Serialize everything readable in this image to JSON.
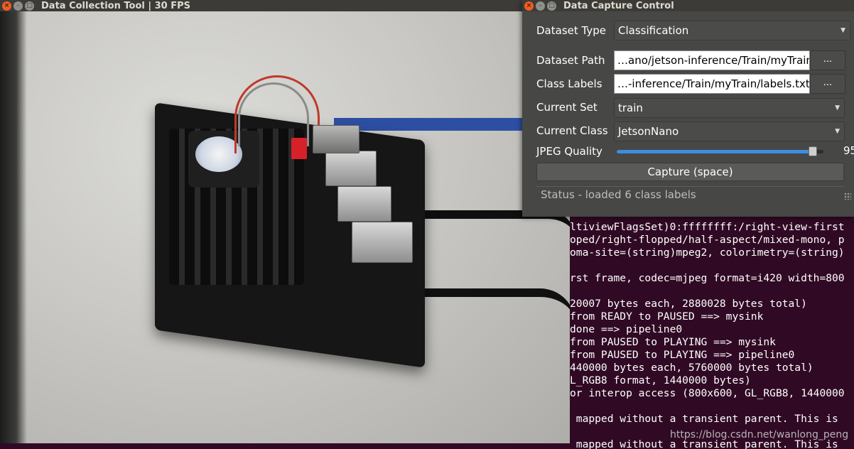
{
  "camera_window": {
    "title": "Data Collection Tool | 30 FPS",
    "controls": {
      "close": "×",
      "minimize": "–",
      "maximize": "□"
    }
  },
  "dialog": {
    "title": "Data Capture Control",
    "controls": {
      "close": "×",
      "minimize": "–",
      "maximize": "□"
    },
    "dataset_type": {
      "label": "Dataset Type",
      "value": "Classification"
    },
    "dataset_path": {
      "label": "Dataset Path",
      "value": "…ano/jetson-inference/Train/myTrain",
      "browse_label": "..."
    },
    "class_labels": {
      "label": "Class Labels",
      "value": "…-inference/Train/myTrain/labels.txt",
      "browse_label": "..."
    },
    "current_set": {
      "label": "Current Set",
      "value": "train"
    },
    "current_class": {
      "label": "Current Class",
      "value": "JetsonNano"
    },
    "jpeg_quality": {
      "label": "JPEG Quality",
      "value": "95",
      "level_fraction": 0.95
    },
    "capture_button": "Capture (space)",
    "status": "Status - loaded 6 class labels"
  },
  "terminal": {
    "lines": [
      "ltiviewFlagsSet)0:ffffffff:/right-view-first",
      "oped/right-flopped/half-aspect/mixed-mono, p",
      "oma-site=(string)mpeg2, colorimetry=(string)",
      "",
      "rst frame, codec=mjpeg format=i420 width=800",
      "",
      "20007 bytes each, 2880028 bytes total)",
      "from READY to PAUSED ==> mysink",
      "done ==> pipeline0",
      "from PAUSED to PLAYING ==> mysink",
      "from PAUSED to PLAYING ==> pipeline0",
      "440000 bytes each, 5760000 bytes total)",
      "L_RGB8 format, 1440000 bytes)",
      "or interop access (800x600, GL_RGB8, 1440000",
      "",
      " mapped without a transient parent. This is",
      "",
      " mapped without a transient parent. This is"
    ]
  },
  "watermark": "https://blog.csdn.net/wanlong_peng",
  "colors": {
    "terminal_bg": "#300a24",
    "dialog_bg": "#474745",
    "titlebar_bg": "#3c3b37",
    "close_button": "#f15d22",
    "slider_accent": "#3d8ee0"
  },
  "icons": [
    "close-icon",
    "minimize-icon",
    "maximize-icon",
    "chevron-down-icon",
    "resize-grip-icon"
  ]
}
